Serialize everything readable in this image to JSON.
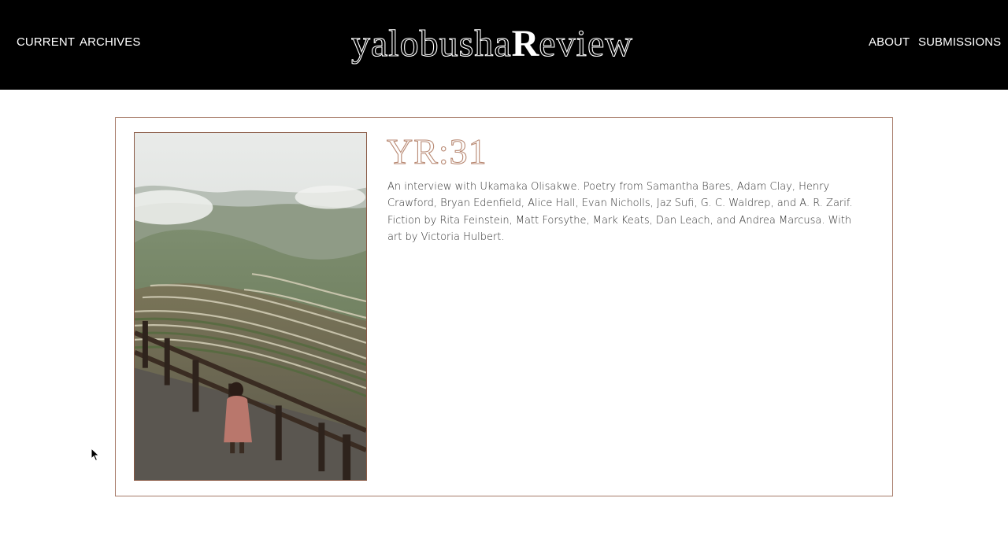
{
  "header": {
    "nav_left": [
      {
        "label": "CURRENT"
      },
      {
        "label": "ARCHIVES"
      }
    ],
    "nav_right": [
      {
        "label": "ABOUT"
      },
      {
        "label": "SUBMISSIONS"
      }
    ],
    "logo": {
      "part_outline": "yalobusha",
      "part_solid": "R",
      "part_outline_end": "eview"
    }
  },
  "issue": {
    "title": "YR:31",
    "description": "An interview with Ukamaka Olisakwe. Poetry from Samantha Bares, Adam Clay, Henry Crawford, Bryan Edenfield, Alice Hall, Evan Nicholls, Jaz Sufi, G. C. Waldrep, and A. R. Zarif. Fiction by Rita Feinstein, Matt Forsythe, Mark Keats, Dan Leach, and Andrea Marcusa. With art by Victoria Hulbert.",
    "cover_image": "rice-terraces-cover-photo"
  },
  "colors": {
    "header_bg": "#000000",
    "accent": "#a67a68",
    "text": "#333333"
  }
}
